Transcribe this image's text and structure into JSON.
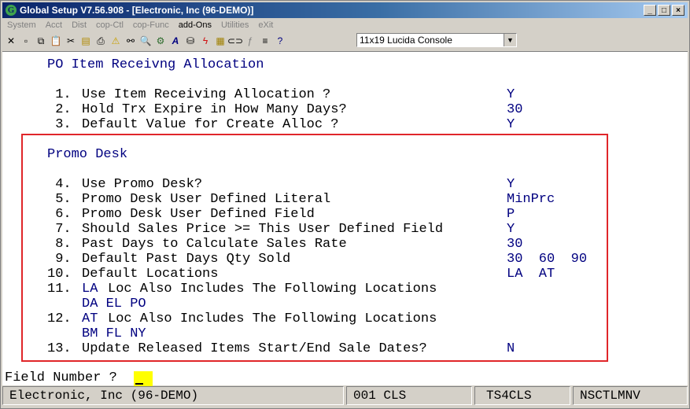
{
  "window": {
    "title": "Global Setup V7.56.908 - [Electronic, Inc (96-DEMO)]",
    "app_icon_glyph": "G",
    "controls": {
      "minimize": "_",
      "restore": "□",
      "close": "×"
    }
  },
  "menu": [
    "System",
    "Acct",
    "Dist",
    "cop-Ctl",
    "cop-Func",
    "add-Ons",
    "Utilities",
    "eXit"
  ],
  "menu_active": "add-Ons",
  "toolbar": {
    "icons": [
      "close-icon",
      "new-icon",
      "copy-icon",
      "paste-icon",
      "cut-icon",
      "notes-icon",
      "print-icon",
      "warning-icon",
      "binoculars-icon",
      "search-icon",
      "settings-icon",
      "font-icon",
      "stamp-icon",
      "lightning-icon",
      "calculator-icon",
      "link-icon",
      "function-icon",
      "list-icon",
      "help-icon"
    ],
    "font_select": "11x19 Lucida Console"
  },
  "screen": {
    "heading": "PO Item Receivng Allocation",
    "items_top": [
      {
        "num": " 1.",
        "label": "Use Item Receiving Allocation ?",
        "value": "Y"
      },
      {
        "num": " 2.",
        "label": "Hold Trx Expire in How Many Days?",
        "value": "30"
      },
      {
        "num": " 3.",
        "label": "Default Value for Create Alloc ?",
        "value": "Y"
      }
    ],
    "promo_heading": "Promo Desk",
    "items_promo": [
      {
        "num": " 4.",
        "label": "Use Promo Desk?",
        "value": "Y"
      },
      {
        "num": " 5.",
        "label": "Promo Desk User Defined Literal",
        "value": "MinPrc"
      },
      {
        "num": " 6.",
        "label": "Promo Desk User Defined Field",
        "value": "P"
      },
      {
        "num": " 7.",
        "label": "Should Sales Price >= This User Defined Field",
        "value": "Y"
      },
      {
        "num": " 8.",
        "label": "Past Days to Calculate Sales Rate",
        "value": "30"
      },
      {
        "num": " 9.",
        "label": "Default Past Days Qty Sold",
        "value": "30  60  90"
      },
      {
        "num": "10.",
        "label": "Default Locations",
        "value": "LA  AT"
      }
    ],
    "item11": {
      "num": "11.",
      "loc": "LA",
      "label": "Loc Also Includes The Following Locations",
      "sub": "DA EL PO"
    },
    "item12": {
      "num": "12.",
      "loc": "AT",
      "label": "Loc Also Includes The Following Locations",
      "sub": "BM FL NY"
    },
    "item13": {
      "num": "13.",
      "label": "Update Released Items Start/End Sale Dates?",
      "value": "N"
    }
  },
  "prompt": {
    "label": "Field Number ?"
  },
  "status": {
    "company": "Electronic, Inc (96-DEMO)",
    "code": "001 CLS",
    "terminal": "TS4CLS",
    "user": "NSCTLMNV"
  },
  "colors": {
    "value_blue": "#000080",
    "highlight_red": "#e0262a",
    "cursor_yellow": "#ffff00"
  }
}
